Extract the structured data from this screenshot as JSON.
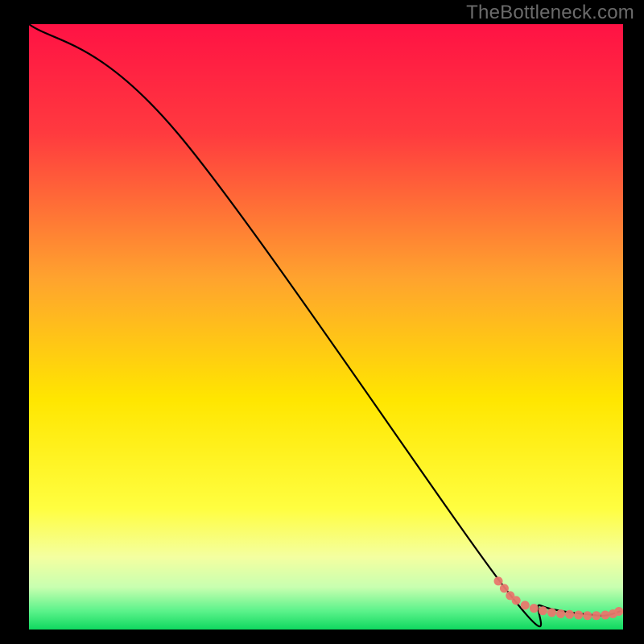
{
  "watermark": {
    "text": "TheBottleneck.com"
  },
  "colors": {
    "background": "#000000",
    "grad_top": "#ff1a4f",
    "grad_mid1": "#ff7a2e",
    "grad_mid2": "#ffe600",
    "grad_low": "#f7ffb0",
    "grad_bottom": "#17e06b",
    "line": "#000000",
    "markers": "#e8776d",
    "watermark": "#6b6b6b"
  },
  "chart_data": {
    "type": "line",
    "title": "",
    "xlabel": "",
    "ylabel": "",
    "xlim": [
      0,
      100
    ],
    "ylim": [
      0,
      100
    ],
    "series": [
      {
        "name": "bottleneck-curve",
        "x": [
          0.0,
          25.0,
          80.0,
          86.0,
          90.0,
          94.0,
          97.0,
          99.5
        ],
        "y": [
          100.0,
          82.0,
          7.0,
          4.0,
          3.0,
          2.5,
          2.3,
          3.0
        ]
      }
    ],
    "markers": {
      "name": "highlight-cluster",
      "points": [
        {
          "x": 79.0,
          "y": 8.0
        },
        {
          "x": 80.0,
          "y": 6.8
        },
        {
          "x": 81.0,
          "y": 5.6
        },
        {
          "x": 82.0,
          "y": 4.8
        },
        {
          "x": 83.5,
          "y": 4.0
        },
        {
          "x": 85.0,
          "y": 3.5
        },
        {
          "x": 86.5,
          "y": 3.1
        },
        {
          "x": 88.0,
          "y": 2.8
        },
        {
          "x": 89.5,
          "y": 2.6
        },
        {
          "x": 91.0,
          "y": 2.5
        },
        {
          "x": 92.5,
          "y": 2.4
        },
        {
          "x": 94.0,
          "y": 2.3
        },
        {
          "x": 95.5,
          "y": 2.3
        },
        {
          "x": 97.0,
          "y": 2.4
        },
        {
          "x": 98.3,
          "y": 2.6
        },
        {
          "x": 99.3,
          "y": 3.0
        }
      ]
    },
    "gradient_stops": [
      {
        "offset": 0,
        "color": "#ff1244"
      },
      {
        "offset": 18,
        "color": "#ff3a3f"
      },
      {
        "offset": 42,
        "color": "#ffa32e"
      },
      {
        "offset": 62,
        "color": "#ffe600"
      },
      {
        "offset": 80,
        "color": "#fffe40"
      },
      {
        "offset": 88,
        "color": "#f4ffa0"
      },
      {
        "offset": 93,
        "color": "#c8ffb0"
      },
      {
        "offset": 97,
        "color": "#5af28a"
      },
      {
        "offset": 100,
        "color": "#0fd85f"
      }
    ]
  }
}
